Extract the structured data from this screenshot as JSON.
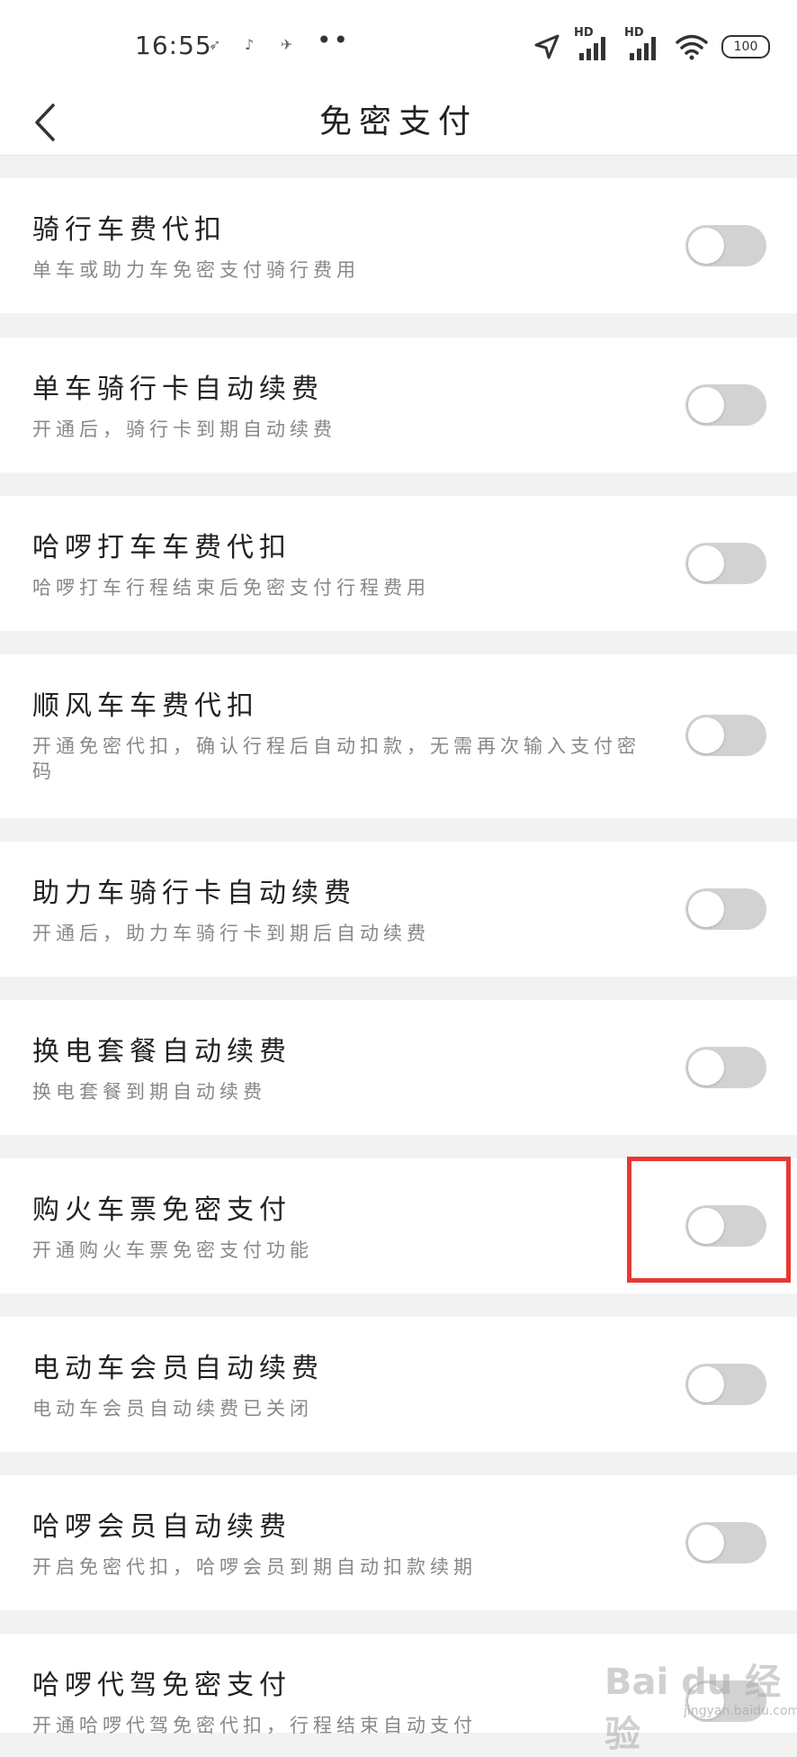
{
  "status_bar": {
    "time": "16:55",
    "notif_icons": [
      "navigation-icon",
      "app-icon",
      "bird-icon"
    ],
    "more": "••",
    "hd1": "HD",
    "hd2": "HD",
    "battery": "100"
  },
  "header": {
    "title": "免密支付",
    "back_icon": "chevron-left-icon"
  },
  "items": [
    {
      "title": "骑行车费代扣",
      "desc": "单车或助力车免密支付骑行费用",
      "enabled": false
    },
    {
      "title": "单车骑行卡自动续费",
      "desc": "开通后，骑行卡到期自动续费",
      "enabled": false
    },
    {
      "title": "哈啰打车车费代扣",
      "desc": "哈啰打车行程结束后免密支付行程费用",
      "enabled": false
    },
    {
      "title": "顺风车车费代扣",
      "desc": "开通免密代扣，确认行程后自动扣款，无需再次输入支付密码",
      "enabled": false
    },
    {
      "title": "助力车骑行卡自动续费",
      "desc": "开通后，助力车骑行卡到期后自动续费",
      "enabled": false
    },
    {
      "title": "换电套餐自动续费",
      "desc": "换电套餐到期自动续费",
      "enabled": false
    },
    {
      "title": "购火车票免密支付",
      "desc": "开通购火车票免密支付功能",
      "enabled": false
    },
    {
      "title": "电动车会员自动续费",
      "desc": "电动车会员自动续费已关闭",
      "enabled": false
    },
    {
      "title": "哈啰会员自动续费",
      "desc": "开启免密代扣，哈啰会员到期自动扣款续期",
      "enabled": false
    },
    {
      "title": "哈啰代驾免密支付",
      "desc": "开通哈啰代驾免密代扣，行程结束自动支付",
      "enabled": false
    }
  ],
  "watermark": {
    "brand": "Bai du 经验",
    "site": "jingyan.baidu.com"
  },
  "colors": {
    "highlight": "#e53935",
    "toggle_off": "#d2d2d2"
  }
}
